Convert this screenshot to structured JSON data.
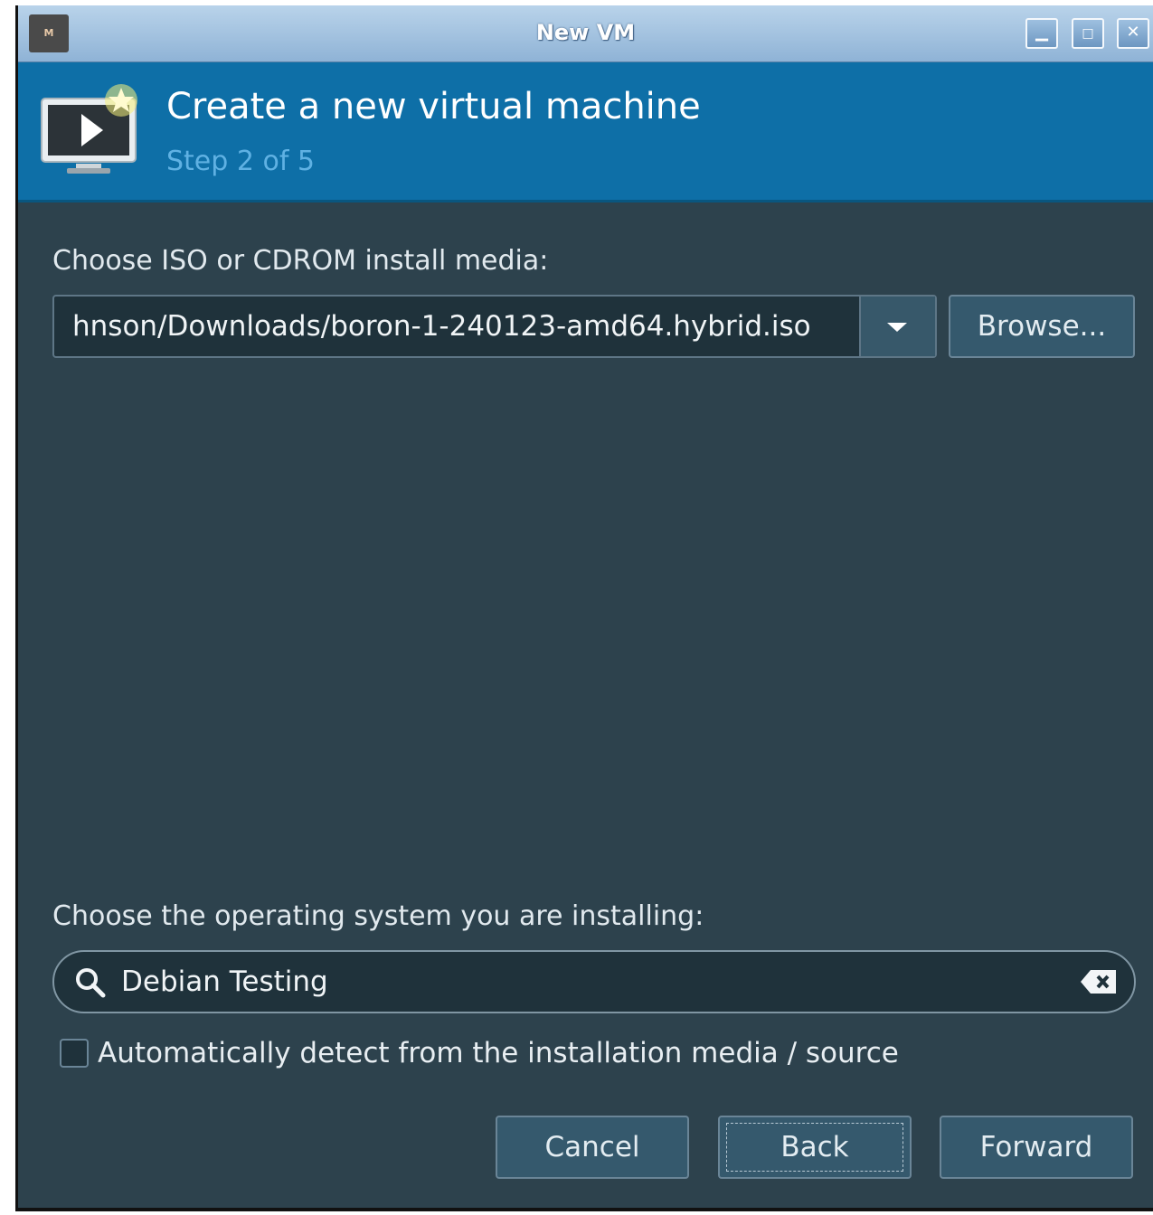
{
  "window": {
    "title": "New VM",
    "app_icon_text": "M"
  },
  "banner": {
    "title": "Create a new virtual machine",
    "step": "Step 2 of 5"
  },
  "media": {
    "label": "Choose ISO or CDROM install media:",
    "value": "hnson/Downloads/boron-1-240123-amd64.hybrid.iso",
    "browse_label": "Browse..."
  },
  "os": {
    "label": "Choose the operating system you are installing:",
    "search_value": "Debian Testing",
    "auto_detect_label": "Automatically detect from the installation media / source",
    "auto_detect_checked": false
  },
  "buttons": {
    "cancel": "Cancel",
    "back": "Back",
    "forward": "Forward"
  },
  "colors": {
    "banner": "#0e6fa7",
    "body": "#2d424d",
    "step_text": "#5fb1e3"
  }
}
